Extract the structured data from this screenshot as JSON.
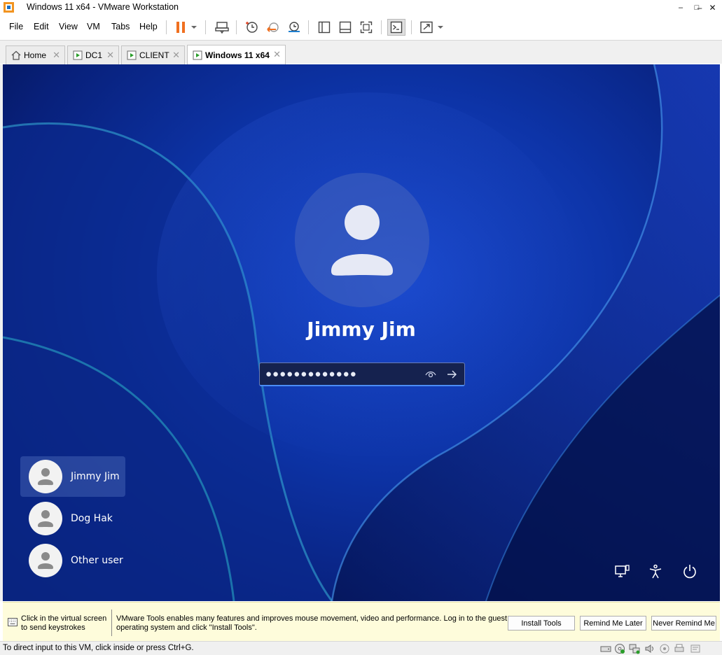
{
  "window": {
    "title": "Windows 11 x64 - VMware Workstation",
    "controls": {
      "minimize": "–",
      "maximize": "□",
      "close": "✕"
    }
  },
  "menu": {
    "items": [
      "File",
      "Edit",
      "View",
      "VM",
      "Tabs",
      "Help"
    ]
  },
  "toolbar": {
    "icons": [
      "suspend-icon",
      "dropdown-icon",
      "send-ctrl-alt-del-icon",
      "snapshot-take-icon",
      "snapshot-revert-icon",
      "snapshot-manager-icon",
      "library-view-icon",
      "thumbnail-view-icon",
      "full-screen-icon",
      "console-view-icon",
      "stretch-guest-icon",
      "dropdown-icon"
    ]
  },
  "tabs": [
    {
      "label": "Home",
      "icon": "home-icon",
      "active": false
    },
    {
      "label": "DC1",
      "icon": "vm-running-icon",
      "active": false
    },
    {
      "label": "CLIENT",
      "icon": "vm-running-icon",
      "active": false
    },
    {
      "label": "Windows 11 x64",
      "icon": "vm-running-icon",
      "active": true
    }
  ],
  "login": {
    "user_name": "Jimmy Jim",
    "password_masked": "●●●●●●●●●●●●●",
    "users": [
      {
        "name": "Jimmy Jim",
        "selected": true
      },
      {
        "name": "Dog Hak",
        "selected": false
      },
      {
        "name": "Other user",
        "selected": false
      }
    ],
    "system_icons": [
      "network-icon",
      "accessibility-icon",
      "power-icon"
    ]
  },
  "infobar": {
    "click_hint_line1": "Click in the virtual screen",
    "click_hint_line2": "to send keystrokes",
    "message_line1": "VMware Tools enables many features and improves mouse movement, video and performance. Log in to the guest",
    "message_line2": "operating system and click \"Install Tools\".",
    "install_button": "Install Tools",
    "remind_button": "Remind Me Later",
    "never_button": "Never Remind Me"
  },
  "statusbar": {
    "text": "To direct input to this VM, click inside or press Ctrl+G.",
    "device_icons": [
      "hard-disk-icon",
      "cd-dvd-icon",
      "network-adapter-icon",
      "sound-icon",
      "usb-icon",
      "printer-icon"
    ]
  },
  "colors": {
    "accent_orange": "#f07020",
    "login_accent": "#4c8df6",
    "infobar_bg": "#fefcdb"
  }
}
